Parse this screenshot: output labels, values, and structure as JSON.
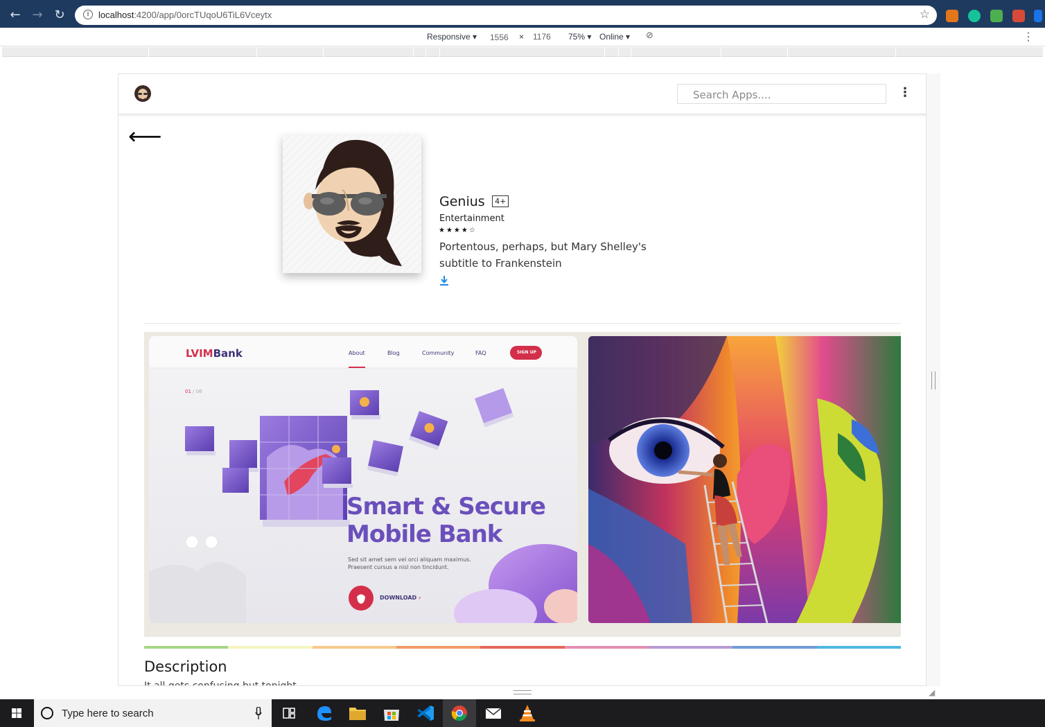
{
  "browser": {
    "url_host": "localhost",
    "url_path": ":4200/app/0orcTUqoU6TiL6Vceytx"
  },
  "device_toolbar": {
    "mode": "Responsive",
    "width": "1556",
    "times": "×",
    "height": "1176",
    "zoom": "75%",
    "network": "Online"
  },
  "header": {
    "search_placeholder": "Search Apps...."
  },
  "app": {
    "title": "Genius",
    "age_rating": "4+",
    "category": "Entertainment",
    "rating_stars": "★★★★☆",
    "rating": 4,
    "description": "Portentous, perhaps, but Mary Shelley's subtitle to Frankenstein"
  },
  "screenshot1": {
    "brand_red": "LVIM",
    "brand_dark": "Bank",
    "nav": [
      "About",
      "Blog",
      "Community",
      "FAQ"
    ],
    "signup": "SIGN UP",
    "counter_current": "01",
    "counter_total": "/ 06",
    "headline_1": "Smart & Secure",
    "headline_2": "Mobile Bank",
    "sub_1": "Sed sit amet sem vel orci aliquam maximus.",
    "sub_2": "Praesent cursus a nisl non tincidunt.",
    "download": "DOWNLOAD"
  },
  "description": {
    "heading": "Description",
    "body": "It all gets confusing but tonight..."
  },
  "taskbar": {
    "search_placeholder": "Type here to search"
  },
  "colors": {
    "chrome_bg": "#1f3a5f",
    "brand_red": "#d32f4b",
    "brand_purple": "#6b4fbb",
    "rainbow": [
      "#a6d785",
      "#f4f4c0",
      "#f7c98b",
      "#f29a66",
      "#e2685a",
      "#e58fb1",
      "#b69ad6",
      "#6f9bd8",
      "#4fb7e3"
    ]
  },
  "icons": {
    "back": "arrow-left-icon",
    "download": "download-icon",
    "kebab": "more-vert-icon"
  }
}
